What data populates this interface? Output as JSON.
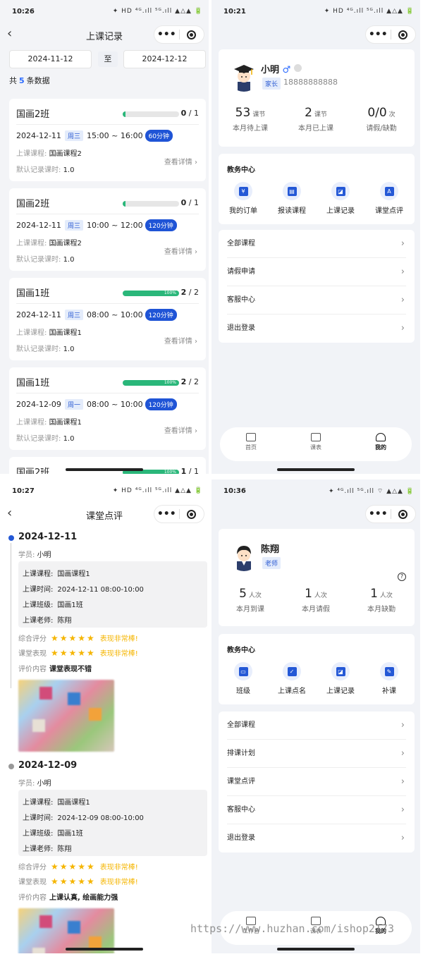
{
  "panel1": {
    "time": "10:26",
    "status_icons": "✦ HD ⁴ᴳ.ıll ⁵ᴳ.ıll ▲△▲ 🔋",
    "title": "上课记录",
    "date_from": "2024-11-12",
    "date_sep": "至",
    "date_to": "2024-12-12",
    "total_prefix": "共",
    "total_count": "5",
    "total_suffix": "条数据",
    "labels": {
      "course": "上课课程:",
      "hours": "默认记录课时:",
      "detail": "查看详情"
    },
    "records": [
      {
        "class": "国画2班",
        "progress": 0,
        "progress_text": "",
        "done": "0",
        "total": "/ 1",
        "date": "2024-12-11",
        "weekday": "周三",
        "time": "15:00 ~ 16:00",
        "duration": "60分钟",
        "course": "国画课程2",
        "hours": "1.0"
      },
      {
        "class": "国画2班",
        "progress": 0,
        "progress_text": "",
        "done": "0",
        "total": "/ 1",
        "date": "2024-12-11",
        "weekday": "周三",
        "time": "10:00 ~ 12:00",
        "duration": "120分钟",
        "course": "国画课程2",
        "hours": "1.0"
      },
      {
        "class": "国画1班",
        "progress": 100,
        "progress_text": "100%",
        "done": "2",
        "total": "/ 2",
        "date": "2024-12-11",
        "weekday": "周三",
        "time": "08:00 ~ 10:00",
        "duration": "120分钟",
        "course": "国画课程1",
        "hours": "1.0"
      },
      {
        "class": "国画1班",
        "progress": 100,
        "progress_text": "100%",
        "done": "2",
        "total": "/ 2",
        "date": "2024-12-09",
        "weekday": "周一",
        "time": "08:00 ~ 10:00",
        "duration": "120分钟",
        "course": "国画课程1",
        "hours": "1.0"
      },
      {
        "class": "国画2班",
        "progress": 100,
        "progress_text": "100%",
        "done": "1",
        "total": "/ 1"
      }
    ]
  },
  "panel2": {
    "time": "10:21",
    "status_icons": "✦ HD ⁴ᴳ.ıll ⁵ᴳ.ıll ▲△▲ 🔋",
    "name": "小明",
    "gender": "♂",
    "role": "家长",
    "phone": "18888888888",
    "stats": [
      {
        "num": "53",
        "unit": "课节",
        "label": "本月待上课"
      },
      {
        "num": "2",
        "unit": "课节",
        "label": "本月已上课"
      },
      {
        "num": "0/0",
        "unit": "次",
        "label": "请假/缺勤"
      }
    ],
    "edu_title": "教务中心",
    "edu_items": [
      {
        "icon": "order-icon",
        "glyph": "¥",
        "label": "我的订单"
      },
      {
        "icon": "enroll-icon",
        "glyph": "▤",
        "label": "报读课程"
      },
      {
        "icon": "record-icon",
        "glyph": "◪",
        "label": "上课记录"
      },
      {
        "icon": "review-icon",
        "glyph": "A",
        "label": "课堂点评"
      }
    ],
    "menu": [
      "全部课程",
      "请假申请",
      "客服中心",
      "退出登录"
    ],
    "tabs": [
      "首页",
      "课表",
      "我的"
    ]
  },
  "panel3": {
    "time": "10:27",
    "status_icons": "✦ HD ⁴ᴳ.ıll ⁵ᴳ.ıll ▲△▲ 🔋",
    "title": "课堂点评",
    "labels": {
      "student": "学员:",
      "course": "上课课程:",
      "time": "上课时间:",
      "class": "上课班级:",
      "teacher": "上课老师:",
      "overall": "综合评分",
      "perf": "课堂表现",
      "comment": "评价内容"
    },
    "entries": [
      {
        "date": "2024-12-11",
        "student": "小明",
        "course": "国画课程1",
        "time": "2024-12-11 08:00-10:00",
        "class": "国画1班",
        "teacher": "陈翔",
        "overall_stars": 5,
        "overall_text": "表现非常棒!",
        "perf_stars": 5,
        "perf_text": "表现非常棒!",
        "comment": "课堂表现不错"
      },
      {
        "date": "2024-12-09",
        "student": "小明",
        "course": "国画课程1",
        "time": "2024-12-09 08:00-10:00",
        "class": "国画1班",
        "teacher": "陈翔",
        "overall_stars": 5,
        "overall_text": "表现非常棒!",
        "perf_stars": 5,
        "perf_text": "表现非常棒!",
        "comment": "上课认真, 绘画能力强"
      }
    ]
  },
  "panel4": {
    "time": "10:36",
    "status_icons": "✦ ⁴ᴳ.ıll ⁵ᴳ.ıll ⌔ ▲△▲ 🔋",
    "name": "陈翔",
    "role": "老师",
    "help": "?",
    "stats": [
      {
        "num": "5",
        "unit": "人次",
        "label": "本月到课"
      },
      {
        "num": "1",
        "unit": "人次",
        "label": "本月请假"
      },
      {
        "num": "1",
        "unit": "人次",
        "label": "本月缺勤"
      }
    ],
    "edu_title": "教务中心",
    "edu_items": [
      {
        "icon": "class-icon",
        "glyph": "▭",
        "label": "班级"
      },
      {
        "icon": "rollcall-icon",
        "glyph": "✓",
        "label": "上课点名"
      },
      {
        "icon": "record-icon",
        "glyph": "◪",
        "label": "上课记录"
      },
      {
        "icon": "makeup-icon",
        "glyph": "✎",
        "label": "补课"
      }
    ],
    "menu": [
      "全部课程",
      "排课计划",
      "课堂点评",
      "客服中心",
      "退出登录"
    ],
    "tabs": [
      "工作台",
      "课表",
      "我的"
    ]
  },
  "watermark": "https://www.huzhan.com/ishop2173"
}
